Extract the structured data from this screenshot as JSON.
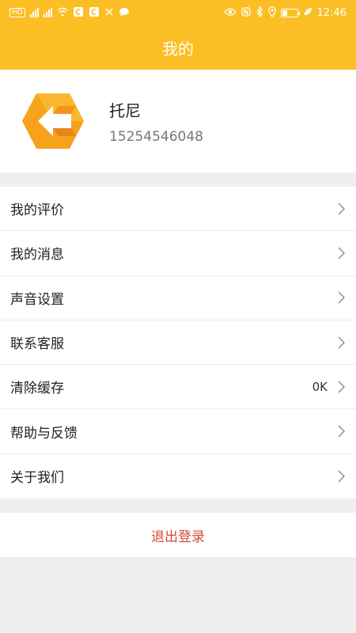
{
  "status_bar": {
    "left_chip": "HD",
    "time": "12:46",
    "battery_level": 0.37
  },
  "header": {
    "title": "我的"
  },
  "profile": {
    "name": "托尼",
    "phone": "15254546048"
  },
  "menu": {
    "items": [
      {
        "label": "我的评价"
      },
      {
        "label": "我的消息"
      },
      {
        "label": "声音设置"
      },
      {
        "label": "联系客服"
      },
      {
        "label": "清除缓存",
        "value": "0K"
      },
      {
        "label": "帮助与反馈"
      },
      {
        "label": "关于我们"
      }
    ]
  },
  "logout": {
    "label": "退出登录"
  },
  "colors": {
    "accent": "#fbbf25",
    "logo_orange": "#f7a21b",
    "logout_red": "#d9473a"
  }
}
